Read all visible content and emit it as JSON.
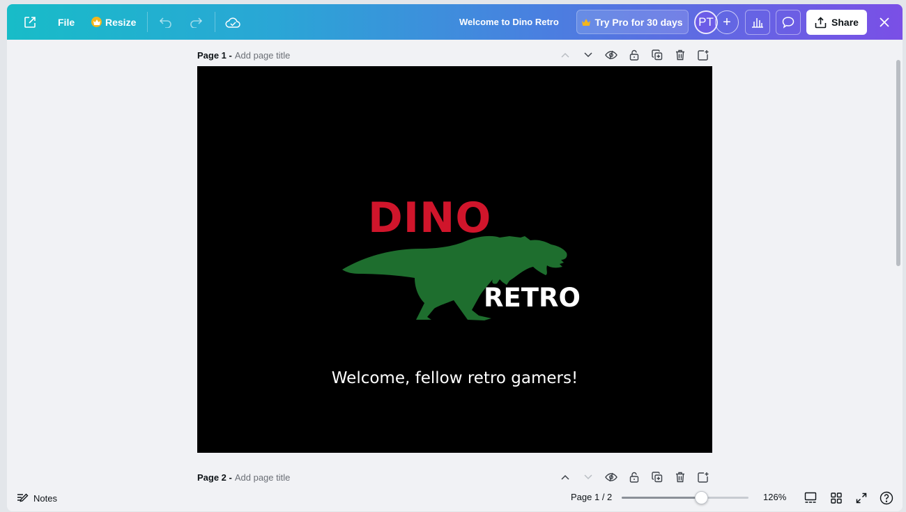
{
  "topbar": {
    "file_label": "File",
    "resize_label": "Resize",
    "doc_title": "Welcome to Dino Retro",
    "try_pro_label": "Try Pro for 30 days",
    "avatar_initials": "PT",
    "add_label": "+",
    "share_label": "Share"
  },
  "pages": [
    {
      "label": "Page 1 -",
      "title_placeholder": "Add page title"
    },
    {
      "label": "Page 2 -",
      "title_placeholder": "Add page title"
    }
  ],
  "canvas": {
    "logo_top": "DINO",
    "logo_bottom": "RETRO",
    "welcome_text": "Welcome, fellow retro gamers!"
  },
  "bottombar": {
    "notes_label": "Notes",
    "page_count": "Page 1 / 2",
    "zoom_label": "126%",
    "zoom_fraction": 0.63
  },
  "colors": {
    "dino_red": "#d0152b",
    "dino_green": "#1e6e2e",
    "gradient_start": "#18bcc8",
    "gradient_end": "#7a4fe6"
  }
}
